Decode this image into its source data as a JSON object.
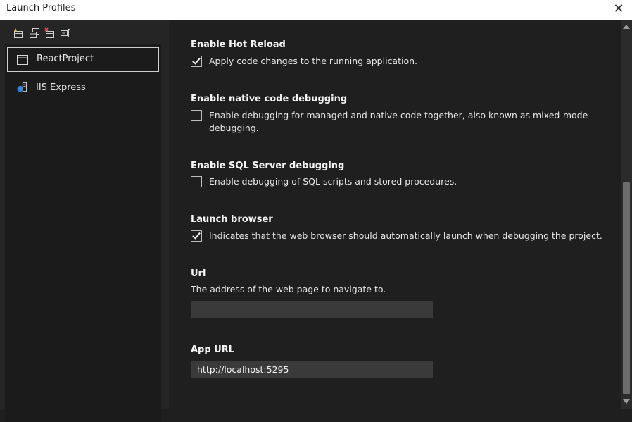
{
  "window": {
    "title": "Launch Profiles",
    "close_glyph": "✕"
  },
  "toolbar": {
    "icons": [
      "new-profile-icon",
      "copy-profile-icon",
      "delete-profile-icon",
      "rename-profile-icon"
    ]
  },
  "profiles": [
    {
      "label": "ReactProject",
      "icon": "project-icon",
      "selected": true
    },
    {
      "label": "IIS Express",
      "icon": "iis-express-icon",
      "selected": false
    }
  ],
  "settings": {
    "hot_reload": {
      "title": "Enable Hot Reload",
      "label": "Apply code changes to the running application.",
      "checked": true
    },
    "native_debugging": {
      "title": "Enable native code debugging",
      "label": "Enable debugging for managed and native code together, also known as mixed-mode debugging.",
      "checked": false
    },
    "sql_debugging": {
      "title": "Enable SQL Server debugging",
      "label": "Enable debugging of SQL scripts and stored procedures.",
      "checked": false
    },
    "launch_browser": {
      "title": "Launch browser",
      "label": "Indicates that the web browser should automatically launch when debugging the project.",
      "checked": true
    },
    "url": {
      "title": "Url",
      "description": "The address of the web page to navigate to.",
      "value": ""
    },
    "app_url": {
      "title": "App URL",
      "value": "http://localhost:5295"
    }
  },
  "colors": {
    "background": "#1f1f1f",
    "sidebar": "#252526",
    "input": "#3a3a3a",
    "titlebar": "#ffffff"
  }
}
